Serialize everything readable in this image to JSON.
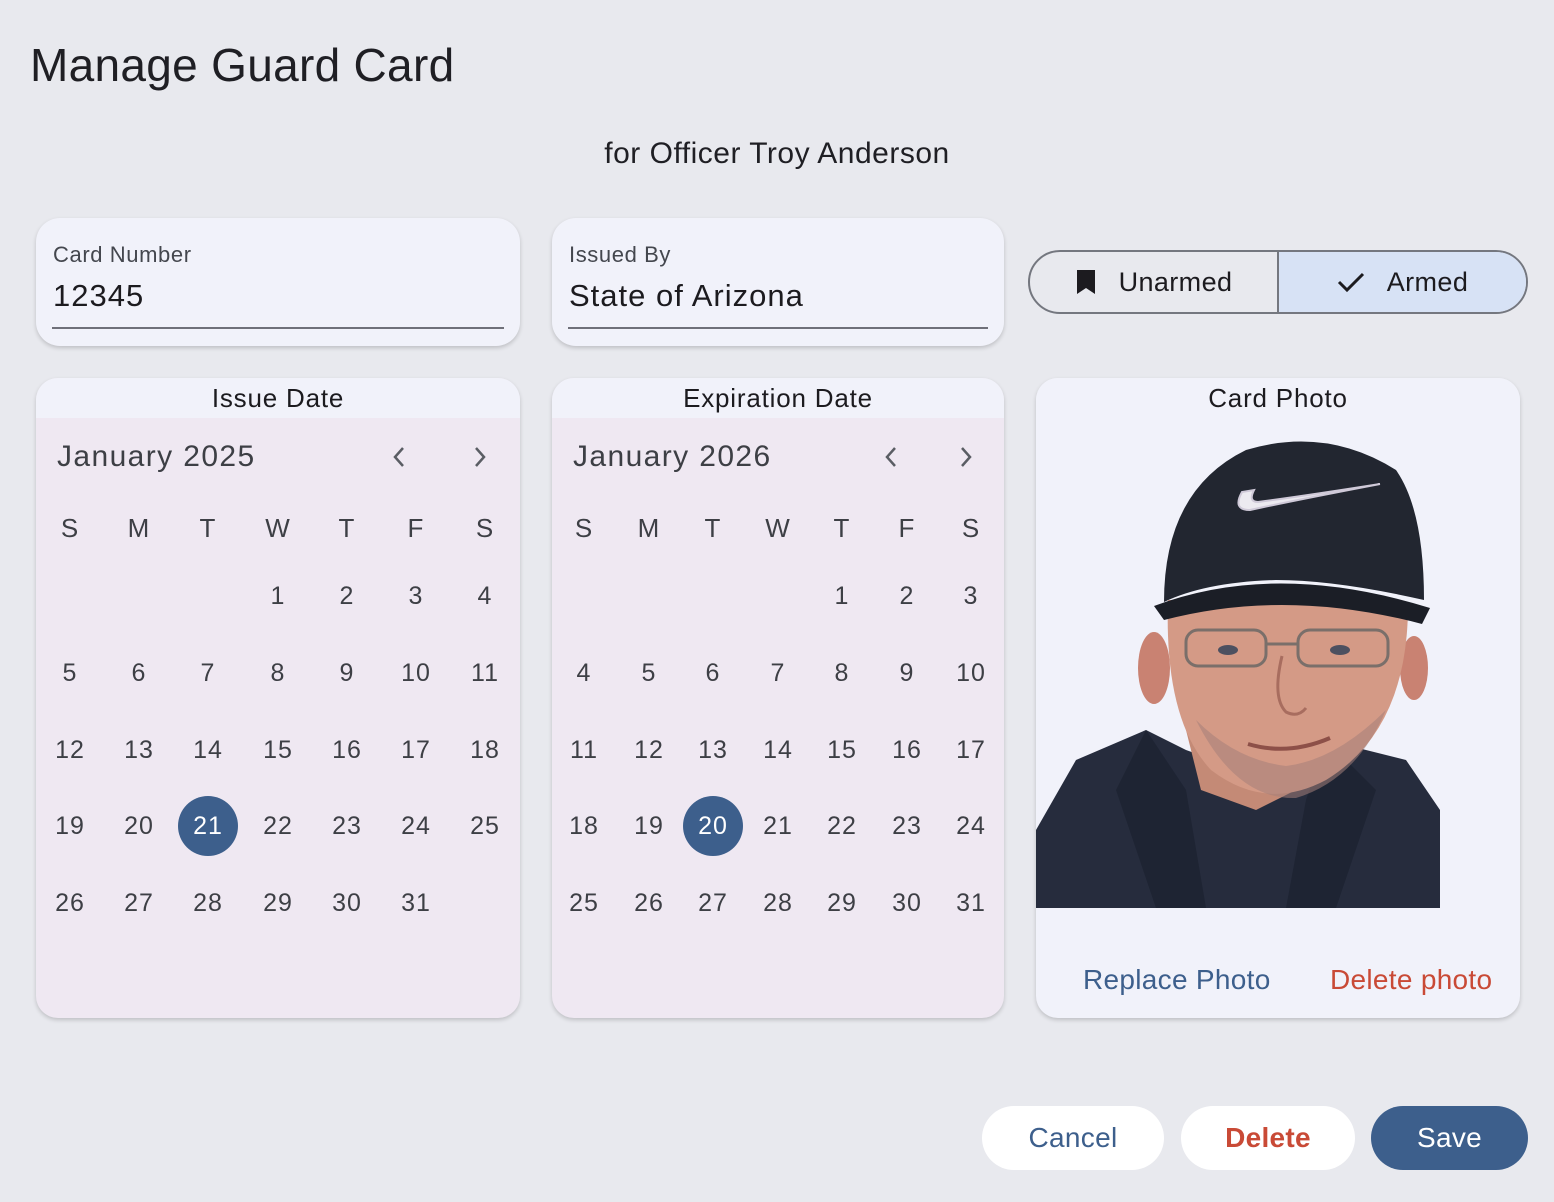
{
  "header": {
    "title": "Manage Guard Card",
    "subtitle": "for Officer Troy Anderson"
  },
  "fields": {
    "card_number": {
      "label": "Card Number",
      "value": "12345"
    },
    "issued_by": {
      "label": "Issued By",
      "value": "State of Arizona"
    }
  },
  "armed_toggle": {
    "options": [
      {
        "label": "Unarmed",
        "icon": "bookmark-icon",
        "selected": false
      },
      {
        "label": "Armed",
        "icon": "check-icon",
        "selected": true
      }
    ]
  },
  "issue_date": {
    "title": "Issue Date",
    "month_label": "January 2025",
    "weekdays": [
      "S",
      "M",
      "T",
      "W",
      "T",
      "F",
      "S"
    ],
    "first_weekday": 3,
    "days_in_month": 31,
    "selected_day": 21
  },
  "expiration_date": {
    "title": "Expiration Date",
    "month_label": "January 2026",
    "weekdays": [
      "S",
      "M",
      "T",
      "W",
      "T",
      "F",
      "S"
    ],
    "first_weekday": 4,
    "days_in_month": 31,
    "selected_day": 20
  },
  "card_photo": {
    "title": "Card Photo",
    "replace_label": "Replace Photo",
    "delete_label": "Delete photo"
  },
  "actions": {
    "cancel_label": "Cancel",
    "delete_label": "Delete",
    "save_label": "Save"
  },
  "colors": {
    "primary": "#3d5f8c",
    "danger": "#c94a36",
    "selected_segment": "#d7e2f5",
    "background": "#e8e9ee"
  }
}
